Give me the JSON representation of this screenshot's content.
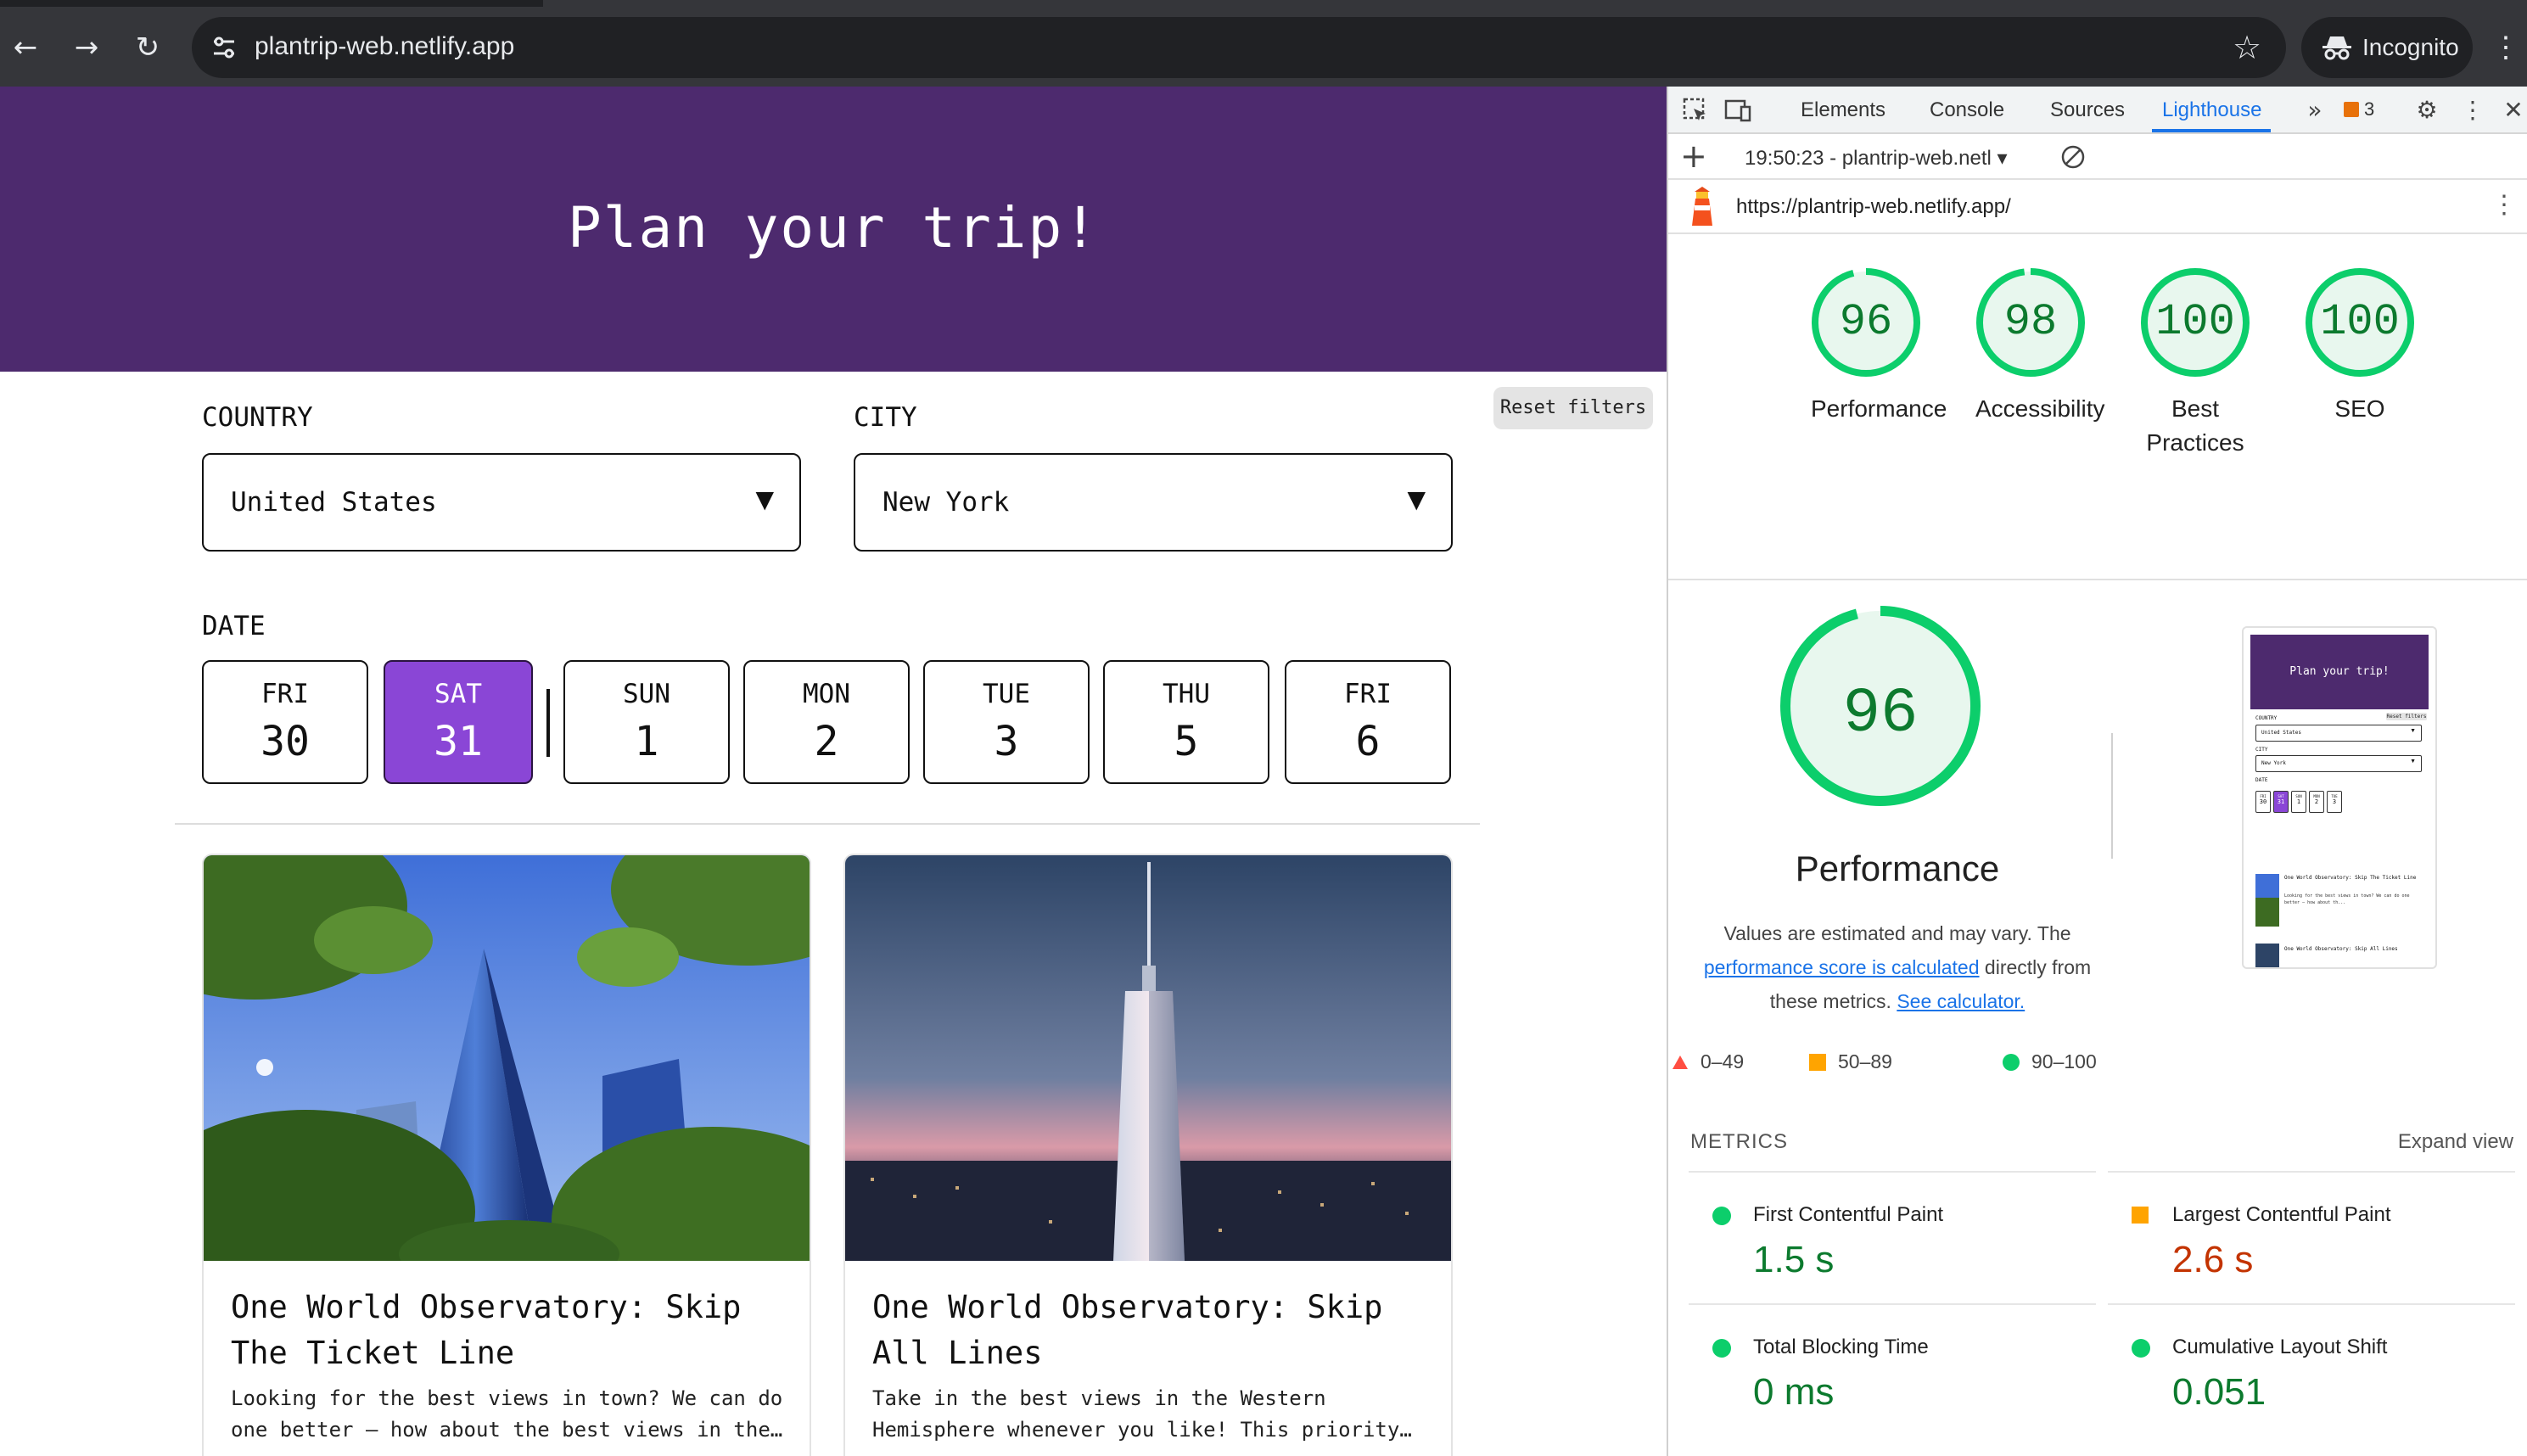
{
  "browser": {
    "url": "plantrip-web.netlify.app",
    "profile_label": "Incognito",
    "icons": [
      "back-arrow-icon",
      "forward-arrow-icon",
      "reload-icon",
      "site-settings-icon",
      "bookmark-star-icon",
      "incognito-icon",
      "kebab-menu-icon"
    ]
  },
  "page": {
    "hero_title": "Plan your trip!",
    "country_label": "COUNTRY",
    "country_value": "United States",
    "city_label": "CITY",
    "city_value": "New York",
    "reset_label": "Reset filters",
    "date_label": "DATE",
    "dates": [
      {
        "dow": "FRI",
        "day": "30",
        "selected": false
      },
      {
        "dow": "SAT",
        "day": "31",
        "selected": true
      },
      {
        "dow": "SUN",
        "day": "1",
        "selected": false
      },
      {
        "dow": "MON",
        "day": "2",
        "selected": false
      },
      {
        "dow": "TUE",
        "day": "3",
        "selected": false
      },
      {
        "dow": "THU",
        "day": "5",
        "selected": false
      },
      {
        "dow": "FRI",
        "day": "6",
        "selected": false
      }
    ],
    "cards": [
      {
        "title": "One World Observatory: Skip The Ticket Line",
        "description": "Looking for the best views in town? We can do one better – how about the best views in the…"
      },
      {
        "title": "One World Observatory: Skip All Lines",
        "description": "Take in the best views in the Western Hemisphere whenever you like! This priority…"
      }
    ],
    "colors": {
      "hero": "#4d2a6e",
      "selected_date": "#8a46d6"
    }
  },
  "devtools": {
    "tabs": [
      "Elements",
      "Console",
      "Sources",
      "Lighthouse"
    ],
    "active_tab": "Lighthouse",
    "issues_count": "3",
    "report_selector": "19:50:23 - plantrip-web.netl",
    "audited_url": "https://plantrip-web.netlify.app/",
    "scores": [
      {
        "score": "96",
        "label": "Performance"
      },
      {
        "score": "98",
        "label": "Accessibility"
      },
      {
        "score": "100",
        "label": "Best Practices"
      },
      {
        "score": "100",
        "label": "SEO"
      }
    ],
    "performance": {
      "score": "96",
      "title": "Performance",
      "desc_1": "Values are estimated and may vary. The",
      "desc_link_1": "performance score is calculated",
      "desc_2": " directly from",
      "desc_3": "these metrics. ",
      "desc_link_2": "See calculator."
    },
    "legend": [
      "0–49",
      "50–89",
      "90–100"
    ],
    "thumbnail": {
      "hero": "Plan your trip!",
      "reset": "Reset filters",
      "country_label": "COUNTRY",
      "country_value": "United States",
      "city_label": "CITY",
      "city_value": "New York",
      "date_label": "DATE",
      "dates": [
        {
          "dow": "FRI",
          "day": "30"
        },
        {
          "dow": "SAT",
          "day": "31"
        },
        {
          "dow": "SUN",
          "day": "1"
        },
        {
          "dow": "MON",
          "day": "2"
        },
        {
          "dow": "TUE",
          "day": "3"
        }
      ],
      "card1_title": "One World Observatory: Skip The Ticket Line",
      "card1_desc": "Looking for the best views in town? We can do one better – how about th...",
      "card2_title": "One World Observatory: Skip All Lines"
    },
    "metrics_heading": "METRICS",
    "expand_label": "Expand view",
    "metrics": [
      {
        "name": "First Contentful Paint",
        "value": "1.5 s",
        "rating": "pass"
      },
      {
        "name": "Largest Contentful Paint",
        "value": "2.6 s",
        "rating": "average"
      },
      {
        "name": "Total Blocking Time",
        "value": "0 ms",
        "rating": "pass"
      },
      {
        "name": "Cumulative Layout Shift",
        "value": "0.051",
        "rating": "pass"
      }
    ],
    "colors": {
      "pass": "#0cce6b",
      "average": "#ffa400",
      "fail": "#ff4e42",
      "accent": "#1a73e8"
    }
  }
}
